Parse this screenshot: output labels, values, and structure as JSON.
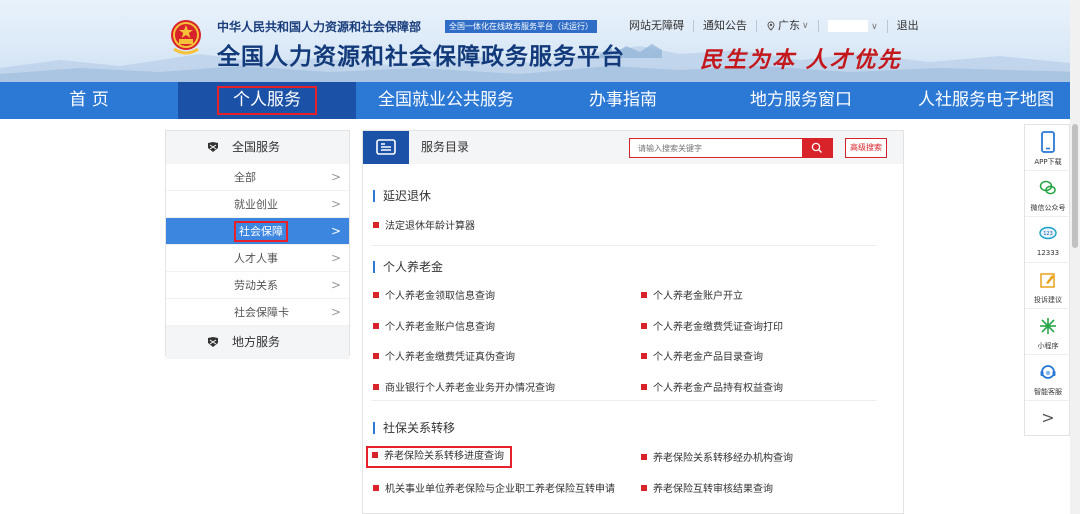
{
  "header": {
    "org_name": "中华人民共和国人力资源和社会保障部",
    "platform_badge": "全国一体化在线政务服务平台（试运行）",
    "site_title": "全国人力资源和社会保障政务服务平台",
    "slogan": "民生为本 人才优先",
    "top_links": {
      "accessibility": "网站无障碍",
      "notice": "通知公告",
      "location": "广东",
      "logout": "退出"
    }
  },
  "nav": {
    "items": [
      "首 页",
      "个人服务",
      "全国就业公共服务",
      "办事指南",
      "地方服务窗口",
      "人社服务电子地图"
    ],
    "active_index": 1
  },
  "sidebar": {
    "national_label": "全国服务",
    "items": [
      "全部",
      "就业创业",
      "社会保障",
      "人才人事",
      "劳动关系",
      "社会保障卡"
    ],
    "active_index": 2,
    "local_label": "地方服务"
  },
  "panel": {
    "title": "服务目录",
    "search_placeholder": "请输入搜索关键字",
    "advanced_search": "高级搜索",
    "sections": [
      {
        "title": "延迟退休",
        "services": [
          "法定退休年龄计算器"
        ]
      },
      {
        "title": "个人养老金",
        "services": [
          "个人养老金领取信息查询",
          "个人养老金账户开立",
          "个人养老金账户信息查询",
          "个人养老金缴费凭证查询打印",
          "个人养老金缴费凭证真伪查询",
          "个人养老金产品目录查询",
          "商业银行个人养老金业务开办情况查询",
          "个人养老金产品持有权益查询"
        ]
      },
      {
        "title": "社保关系转移",
        "services": [
          "养老保险关系转移进度查询",
          "养老保险关系转移经办机构查询",
          "机关事业单位养老保险与企业职工养老保险互转申请",
          "养老保险互转审核结果查询"
        ]
      }
    ]
  },
  "tools": {
    "items": [
      "APP下载",
      "微信公众号",
      "12333",
      "投诉建议",
      "小程序",
      "智能客服"
    ]
  },
  "colors": {
    "nav_blue": "#2b78d5",
    "nav_active": "#1b52a8",
    "highlight_red": "#e8202a",
    "bullet_red": "#d8232a"
  }
}
